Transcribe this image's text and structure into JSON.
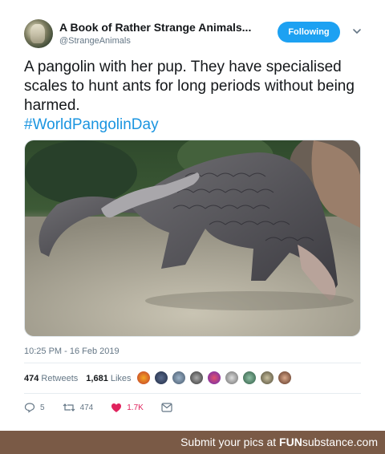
{
  "account": {
    "display_name": "A Book of Rather Strange Animals...",
    "handle": "@StrangeAnimals"
  },
  "follow_button": {
    "label": "Following"
  },
  "tweet": {
    "text": "A pangolin with her pup. They have specialised scales to hunt ants for long periods without being harmed.",
    "hashtag": "#WorldPangolinDay",
    "timestamp": "10:25 PM - 16 Feb 2019"
  },
  "stats": {
    "retweets_count": "474",
    "retweets_label": "Retweets",
    "likes_count": "1,681",
    "likes_label": "Likes"
  },
  "actions": {
    "reply_count": "5",
    "retweet_count": "474",
    "like_count": "1.7K"
  },
  "footer": {
    "prefix": "Submit your pics at",
    "brand_fun": "FUN",
    "brand_rest": "substance.com"
  },
  "icons": [
    "chevron-down-icon",
    "reply-icon",
    "retweet-icon",
    "heart-icon",
    "message-icon"
  ],
  "colors": {
    "accent": "#1da1f2",
    "hashtag": "#1b95e0",
    "like": "#e0245e",
    "footer": "#7a5a46"
  }
}
